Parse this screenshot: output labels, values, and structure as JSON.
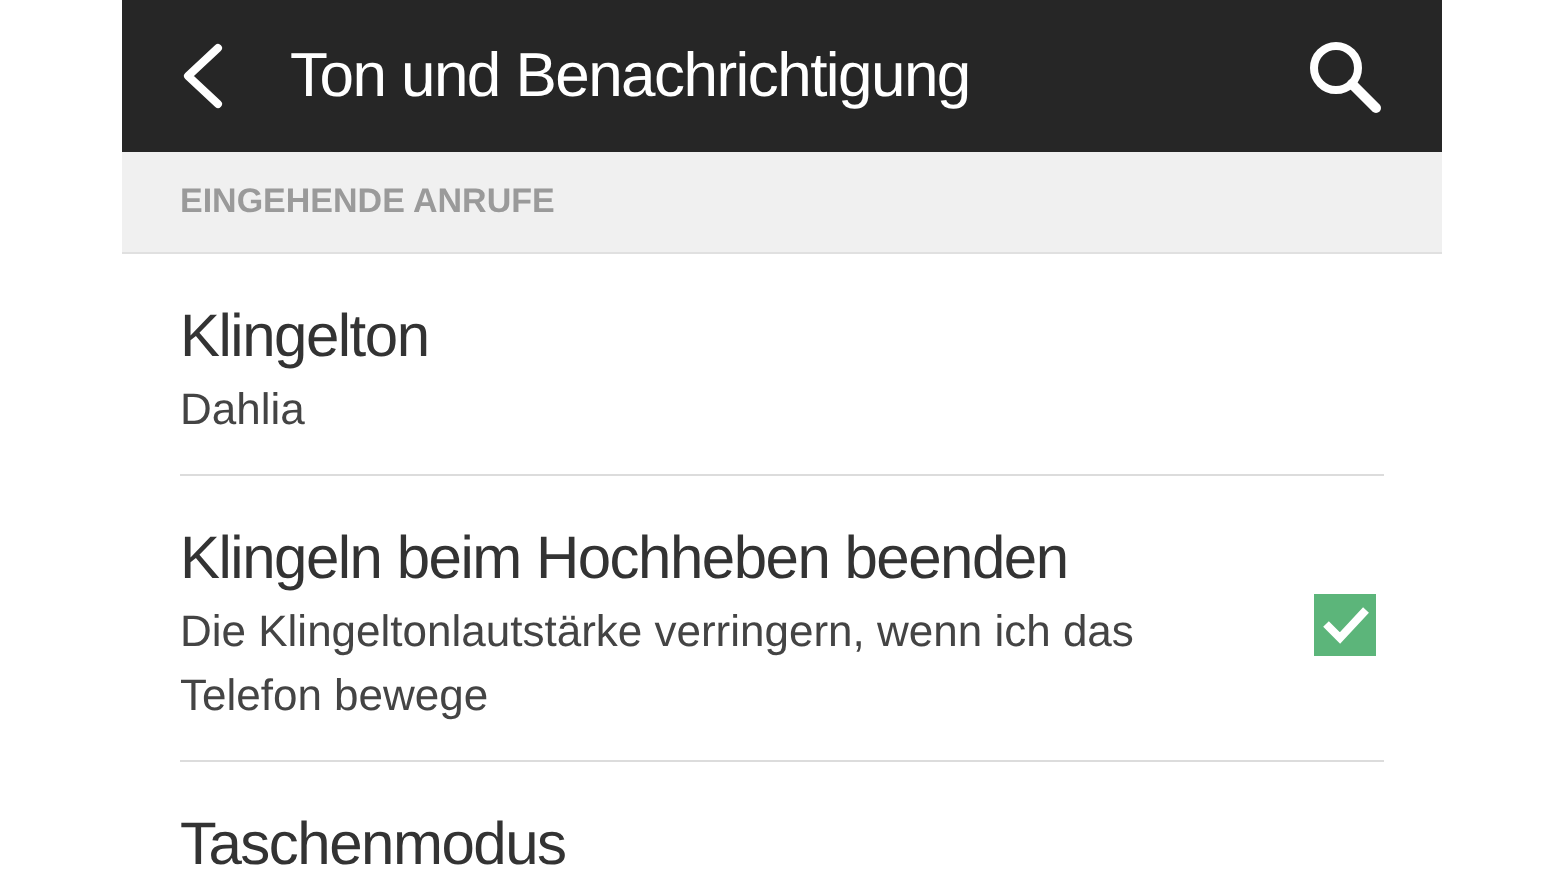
{
  "header": {
    "title": "Ton und Benachrichtigung"
  },
  "section": {
    "title": "EINGEHENDE ANRUFE"
  },
  "items": [
    {
      "kind": "value",
      "title": "Klingelton",
      "subtitle": "Dahlia"
    },
    {
      "kind": "checkbox",
      "title": "Klingeln beim Hochheben beenden",
      "subtitle": "Die Klingeltonlautstärke verringern, wenn ich das Telefon bewege",
      "checked": true
    },
    {
      "kind": "value",
      "title": "Taschenmodus"
    }
  ]
}
